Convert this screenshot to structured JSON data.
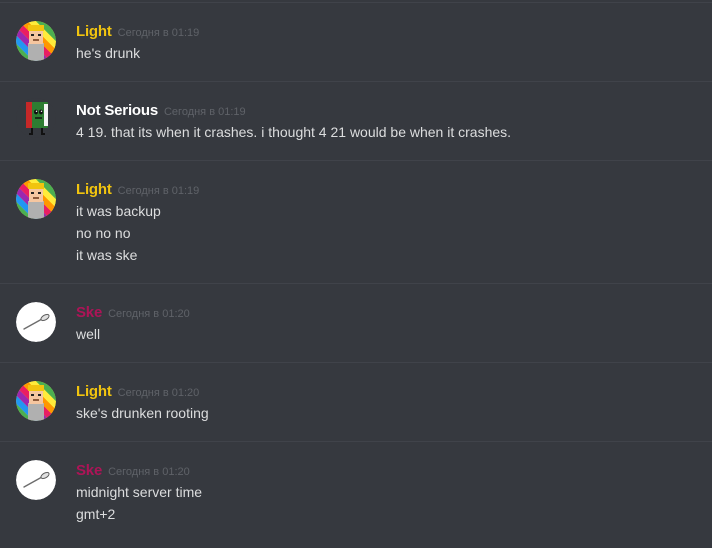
{
  "colors": {
    "background": "#36393f",
    "divider": "#40434a",
    "text": "#dcddde",
    "timestamp": "#5f6268",
    "user_light": "#f1c40f",
    "user_not_serious": "#ffffff",
    "user_ske": "#ad1457"
  },
  "messages": [
    {
      "author": "Light",
      "avatar_icon": "rainbow-striped-cartoon-avatar-icon",
      "timestamp": "Сегодня в 01:19",
      "lines": [
        "he's drunk"
      ]
    },
    {
      "author": "Not Serious",
      "avatar_icon": "green-book-character-avatar-icon",
      "timestamp": "Сегодня в 01:19",
      "lines": [
        "4 19. that its when it crashes. i thought 4 21 would be when it crashes."
      ]
    },
    {
      "author": "Light",
      "avatar_icon": "rainbow-striped-cartoon-avatar-icon",
      "timestamp": "Сегодня в 01:19",
      "lines": [
        "it was backup",
        "no no no",
        "it was ske"
      ]
    },
    {
      "author": "Ske",
      "avatar_icon": "spoon-avatar-icon",
      "timestamp": "Сегодня в 01:20",
      "lines": [
        "well"
      ]
    },
    {
      "author": "Light",
      "avatar_icon": "rainbow-striped-cartoon-avatar-icon",
      "timestamp": "Сегодня в 01:20",
      "lines": [
        "ske's drunken rooting"
      ]
    },
    {
      "author": "Ske",
      "avatar_icon": "spoon-avatar-icon",
      "timestamp": "Сегодня в 01:20",
      "lines": [
        "midnight server time",
        "gmt+2"
      ]
    }
  ]
}
